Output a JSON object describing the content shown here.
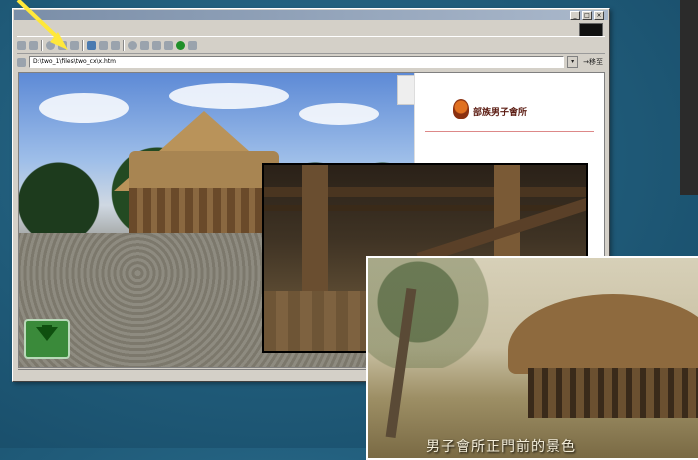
{
  "window": {
    "address": "D:\\two_1\\files\\two_cx\\x.htm",
    "go_label": "→移至"
  },
  "page": {
    "heading": "部族男子會所"
  },
  "overlays": {
    "photo2_caption": "男子會所正門前的景色"
  },
  "colors": {
    "slide_background": "#1f5a78",
    "pointer": "#ffe83a",
    "nav_arrow": "#3a8a3a"
  }
}
